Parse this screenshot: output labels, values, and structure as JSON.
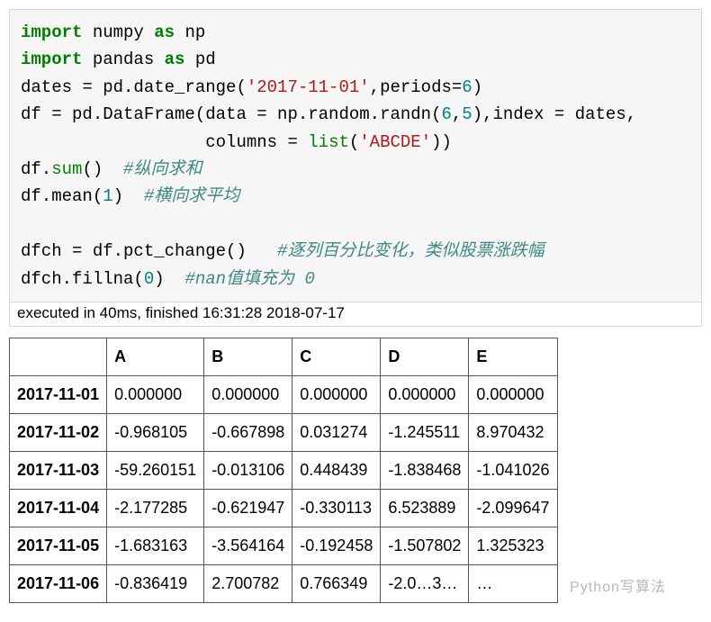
{
  "code": {
    "l1_import": "import",
    "l1_numpy": " numpy ",
    "l1_as": "as",
    "l1_np": " np",
    "l2_import": "import",
    "l2_pandas": " pandas ",
    "l2_as": "as",
    "l2_pd": " pd",
    "l3_a": "dates = pd.date_range(",
    "l3_str": "'2017-11-01'",
    "l3_b": ",periods=",
    "l3_num": "6",
    "l3_c": ")",
    "l4_a": "df = pd.DataFrame(data = np.random.randn(",
    "l4_n1": "6",
    "l4_comma": ",",
    "l4_n2": "5",
    "l4_b": "),index = dates,",
    "l5_a": "                  columns = ",
    "l5_list": "list",
    "l5_b": "(",
    "l5_str": "'ABCDE'",
    "l5_c": "))",
    "l6_a": "df.",
    "l6_sum": "sum",
    "l6_b": "()  ",
    "l6_cmt": "#纵向求和",
    "l7_a": "df.mean(",
    "l7_n": "1",
    "l7_b": ")  ",
    "l7_cmt": "#横向求平均",
    "blank": "",
    "l9_a": "dfch = df.pct_change()   ",
    "l9_cmt": "#逐列百分比变化，类似股票涨跌幅",
    "l10_a": "dfch.fillna(",
    "l10_n": "0",
    "l10_b": ")  ",
    "l10_cmt": "#nan值填充为 0"
  },
  "exec": "executed in 40ms, finished 16:31:28 2018-07-17",
  "chart_data": {
    "type": "table",
    "columns": [
      "A",
      "B",
      "C",
      "D",
      "E"
    ],
    "index": [
      "2017-11-01",
      "2017-11-02",
      "2017-11-03",
      "2017-11-04",
      "2017-11-05",
      "2017-11-06"
    ],
    "rows": [
      [
        "0.000000",
        "0.000000",
        "0.000000",
        "0.000000",
        "0.000000"
      ],
      [
        "-0.968105",
        "-0.667898",
        "0.031274",
        "-1.245511",
        "8.970432"
      ],
      [
        "-59.260151",
        "-0.013106",
        "0.448439",
        "-1.838468",
        "-1.041026"
      ],
      [
        "-2.177285",
        "-0.621947",
        "-0.330113",
        "6.523889",
        "-2.099647"
      ],
      [
        "-1.683163",
        "-3.564164",
        "-0.192458",
        "-1.507802",
        "1.325323"
      ],
      [
        "-0.836419",
        "2.700782",
        "0.766349",
        "-2.0…3…",
        "…"
      ]
    ]
  },
  "watermark": "Python写算法"
}
